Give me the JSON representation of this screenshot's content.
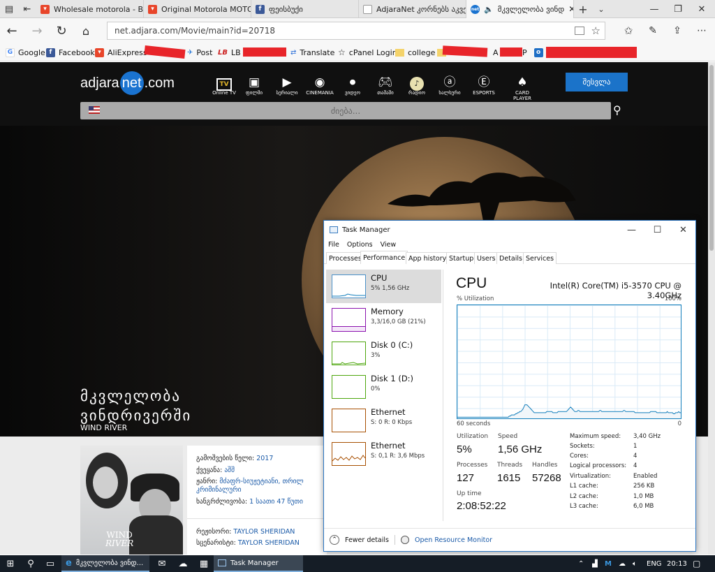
{
  "browser": {
    "tabs": [
      {
        "title": "Wholesale motorola - Buy",
        "icon": "aliexpress-icon",
        "color": "#e8452a"
      },
      {
        "title": "Original Motorola MOTO E",
        "icon": "aliexpress-icon",
        "color": "#e8452a"
      },
      {
        "title": "ფეისბუქი",
        "icon": "facebook-icon",
        "color": "#3b5998"
      },
      {
        "title": "AdjaraNet კორნებს აკვე",
        "icon": "page-icon",
        "color": "#888888"
      },
      {
        "title": "მკვლელობა ვინდ",
        "icon": "adjaranet-icon",
        "color": "#1a73d0"
      }
    ],
    "address": "net.adjara.com/Movie/main?id=20718",
    "favorites": [
      {
        "label": "Google",
        "icon": "google-icon"
      },
      {
        "label": "Facebook",
        "icon": "facebook-icon"
      },
      {
        "label": "AliExpress",
        "icon": "aliexpress-icon"
      },
      {
        "label": "Post",
        "icon": "post-icon"
      },
      {
        "label": "LB",
        "icon": "lb-icon"
      },
      {
        "label": "Translate",
        "icon": "translate-icon"
      },
      {
        "label": "cPanel Login",
        "icon": "star-icon"
      },
      {
        "label": "college",
        "icon": "folder-icon"
      },
      {
        "label": "A",
        "icon": "folder-icon"
      },
      {
        "label": "P",
        "icon": "outlook-icon"
      }
    ]
  },
  "site": {
    "logo": {
      "pre": "adjara",
      "mid": "net",
      "post": ".com"
    },
    "nav": [
      {
        "label": "Online TV",
        "icon": "tv-icon"
      },
      {
        "label": "ფილმი",
        "icon": "film-icon"
      },
      {
        "label": "სერიალი",
        "icon": "play-icon"
      },
      {
        "label": "CINEMANIA",
        "icon": "cinemania-icon"
      },
      {
        "label": "ვიდეო",
        "icon": "video-icon"
      },
      {
        "label": "თამაში",
        "icon": "gamepad-icon"
      },
      {
        "label": "რადიო",
        "icon": "radio-icon"
      },
      {
        "label": "ხალხური",
        "icon": "at-icon"
      },
      {
        "label": "ESPORTS",
        "icon": "esports-icon"
      },
      {
        "label": "CARD PLAYER",
        "icon": "spade-icon"
      }
    ],
    "login_label": "შესვლა",
    "search_placeholder": "ძიება...",
    "hero_title_1": "მკვლელობა",
    "hero_title_2": "ვინდრივერში",
    "hero_subtitle": "WIND RIVER",
    "poster_text_1": "WIND",
    "poster_text_2": "RIVER",
    "details": [
      {
        "label": "გამოშვების წელი:",
        "value": "2017"
      },
      {
        "label": "ქვეყანა:",
        "value": "აშშ"
      },
      {
        "label": "ჟანრი:",
        "value": "მძაფრ-სიუჟეტიანი, თრილ"
      },
      {
        "label": "",
        "value": "კრიმინალური"
      },
      {
        "label": "ხანგრძლივობა:",
        "value": "1 საათი 47 წუთი"
      },
      {
        "label": "რეჟისორი:",
        "value": "TAYLOR SHERIDAN"
      },
      {
        "label": "სცენარისტი:",
        "value": "TAYLOR SHERIDAN"
      }
    ]
  },
  "taskmanager": {
    "title": "Task Manager",
    "menu": [
      "File",
      "Options",
      "View"
    ],
    "tabs": [
      "Processes",
      "Performance",
      "App history",
      "Startup",
      "Users",
      "Details",
      "Services"
    ],
    "active_tab": "Performance",
    "sidebar": [
      {
        "title": "CPU",
        "sub": "5% 1,56 GHz",
        "color": "#117dbb"
      },
      {
        "title": "Memory",
        "sub": "3,3/16,0 GB (21%)",
        "color": "#8b12ae"
      },
      {
        "title": "Disk 0 (C:)",
        "sub": "3%",
        "color": "#4da60c"
      },
      {
        "title": "Disk 1 (D:)",
        "sub": "0%",
        "color": "#4da60c"
      },
      {
        "title": "Ethernet",
        "sub": "S: 0 R: 0 Kbps",
        "color": "#a74f01"
      },
      {
        "title": "Ethernet",
        "sub": "S: 0,1 R: 3,6 Mbps",
        "color": "#a74f01"
      }
    ],
    "cpu": {
      "heading": "CPU",
      "model": "Intel(R) Core(TM) i5-3570 CPU @ 3.40GHz",
      "util_label": "% Utilization",
      "max_label": "100%",
      "time_label": "60 seconds",
      "zero_label": "0",
      "history_percent": [
        1,
        1,
        1,
        1,
        1,
        1,
        1,
        1,
        1,
        1,
        1,
        1,
        1,
        1,
        1,
        1,
        1,
        1,
        1,
        1,
        1,
        1,
        1,
        1,
        1,
        1,
        1,
        1,
        1,
        1,
        1,
        1,
        1,
        1,
        1,
        1,
        1,
        1,
        1,
        1,
        1,
        1,
        1,
        1,
        1,
        1,
        1,
        1,
        1,
        1,
        2,
        2,
        3,
        3,
        3,
        3,
        4,
        4,
        5,
        5,
        6,
        6,
        7,
        8,
        10,
        12,
        12,
        12,
        11,
        10,
        9,
        8,
        7,
        6,
        5,
        5,
        5,
        5,
        5,
        5,
        5,
        5,
        5,
        5,
        5,
        5,
        6,
        6,
        6,
        6,
        6,
        6,
        5,
        5,
        5,
        5,
        5,
        6,
        6,
        6,
        6,
        6,
        6,
        6,
        6,
        6,
        7,
        8,
        9,
        10,
        9,
        8,
        7,
        6,
        6,
        6,
        7,
        7,
        6,
        6,
        6,
        6,
        6,
        6,
        6,
        6,
        6,
        6,
        6,
        6,
        6,
        6,
        6,
        6,
        6,
        6,
        6,
        7,
        7,
        6,
        6,
        6,
        6,
        6,
        6,
        6,
        6,
        6,
        6,
        6,
        6,
        6,
        6,
        6,
        6,
        6,
        6,
        6,
        6,
        6,
        7,
        7,
        6,
        6,
        6,
        6,
        6,
        6,
        6,
        6,
        6,
        5,
        5,
        5,
        5,
        5,
        5,
        5,
        5,
        5,
        5,
        5,
        5,
        5,
        5,
        5,
        6,
        6,
        6,
        6,
        6,
        6,
        5,
        5,
        5,
        5,
        5,
        5,
        5,
        5,
        5,
        5,
        6,
        5,
        5,
        5,
        5,
        5,
        4,
        4,
        5,
        5,
        5,
        6,
        5,
        5
      ],
      "stats": [
        {
          "label": "Utilization",
          "value": "5%"
        },
        {
          "label": "Speed",
          "value": "1,56 GHz"
        },
        {
          "label": "Processes",
          "value": "127"
        },
        {
          "label": "Threads",
          "value": "1615"
        },
        {
          "label": "Handles",
          "value": "57268"
        },
        {
          "label": "Up time",
          "value": "2:08:52:22"
        }
      ],
      "specs": [
        {
          "k": "Maximum speed:",
          "v": "3,40 GHz"
        },
        {
          "k": "Sockets:",
          "v": "1"
        },
        {
          "k": "Cores:",
          "v": "4"
        },
        {
          "k": "Logical processors:",
          "v": "4"
        },
        {
          "k": "Virtualization:",
          "v": "Enabled"
        },
        {
          "k": "L1 cache:",
          "v": "256 KB"
        },
        {
          "k": "L2 cache:",
          "v": "1,0 MB"
        },
        {
          "k": "L3 cache:",
          "v": "6,0 MB"
        }
      ]
    },
    "footer": {
      "fewer": "Fewer details",
      "monitor": "Open Resource Monitor"
    }
  },
  "taskbar": {
    "apps": [
      {
        "label": "მკვლელობა ვინდ...",
        "icon": "edge-icon"
      },
      {
        "label": "Task Manager",
        "icon": "taskmanager-icon"
      }
    ],
    "lang": "ENG",
    "time": "20:13"
  }
}
